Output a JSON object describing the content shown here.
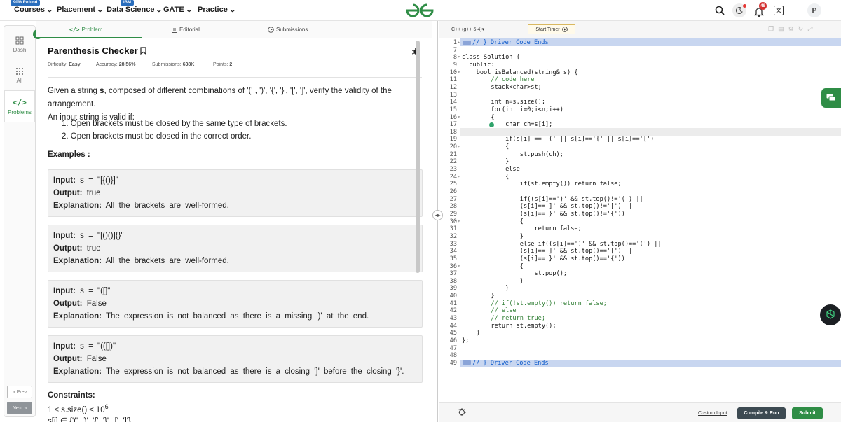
{
  "topnav": {
    "courses": "Courses",
    "courses_badge": "90% Refund",
    "placement": "Placement",
    "data_science": "Data Science",
    "data_science_badge": "IBM",
    "gate": "GATE",
    "practice": "Practice",
    "notification_count": "48",
    "avatar_letter": "P"
  },
  "sidebar": {
    "dash": "Dash",
    "all": "All",
    "problems": "Problems",
    "prev": "« Prev",
    "next": "Next »"
  },
  "tabs": {
    "problem": "Problem",
    "editorial": "Editorial",
    "submissions": "Submissions"
  },
  "problem": {
    "title": "Parenthesis Checker",
    "difficulty_label": "Difficulty:",
    "difficulty": "Easy",
    "accuracy_label": "Accuracy:",
    "accuracy": "28.56%",
    "submissions_label": "Submissions:",
    "submissions": "638K+",
    "points_label": "Points:",
    "points": "2",
    "desc_prefix": "Given a string ",
    "desc_var": "s",
    "desc_suffix": ", composed of different combinations of '(' , ')', '{', '}', '[', ']', verify the validity of the arrangement.",
    "desc_line2": "An input string is valid if:",
    "rules": [
      "1. Open brackets must be closed by the same type of brackets.",
      "2. Open brackets must be closed in the correct order."
    ],
    "examples_title": "Examples :",
    "input_label": "Input:",
    "output_label": "Output:",
    "explanation_label": "Explanation:",
    "examples": [
      {
        "input": "s = \"[{()}]\"",
        "output": "true",
        "explanation": "All the brackets are well-formed."
      },
      {
        "input": "s = \"[()()]{}\"",
        "output": "true",
        "explanation": "All the brackets are well-formed."
      },
      {
        "input": "s = \"([]\"",
        "output": "False",
        "explanation": "The expression is not balanced as there is a missing ')' at the end."
      },
      {
        "input": "s = \"(([])\"",
        "output": "False",
        "explanation": "The expression is not balanced as there is a closing ']' before the closing '}'."
      }
    ],
    "constraints_title": "Constraints:",
    "constraint_1": "1 ≤ s.size() ≤ 10",
    "constraint_1_exp": "6",
    "constraint_2": "s[i] ∈ {'(', ')', '{', '}', '[', ']'}"
  },
  "editor": {
    "language": "C++ (g++ 5.4)",
    "start_timer": "Start Timer",
    "custom_input": "Custom Input",
    "compile_run": "Compile & Run",
    "submit": "Submit",
    "line_numbers": [
      "1",
      "7",
      "8",
      "9",
      "10",
      "11",
      "12",
      "13",
      "14",
      "15",
      "16",
      "17",
      "18",
      "19",
      "20",
      "21",
      "22",
      "23",
      "24",
      "25",
      "26",
      "27",
      "28",
      "29",
      "30",
      "31",
      "32",
      "33",
      "34",
      "35",
      "36",
      "37",
      "38",
      "39",
      "40",
      "41",
      "42",
      "43",
      "44",
      "45",
      "46",
      "47",
      "48",
      "49"
    ],
    "code": {
      "l1": "// } Driver Code Ends",
      "l8": "class Solution {",
      "l9": "  public:",
      "l10": "    bool isBalanced(string& s) {",
      "l11": "        // code here",
      "l12": "        stack<char>st;",
      "l14": "        int n=s.size();",
      "l15": "        for(int i=0;i<n;i++)",
      "l16": "        {",
      "l17": "            char ch=s[i];",
      "l19": "            if(s[i] == '(' || s[i]=='{' || s[i]=='[')",
      "l20": "            {",
      "l21": "                st.push(ch);",
      "l22": "            }",
      "l23": "            else",
      "l24": "            {",
      "l25": "                if(st.empty()) return false;",
      "l27": "                if((s[i]==')' && st.top()!='(') ||",
      "l28": "                (s[i]==']' && st.top()!='[') ||",
      "l29": "                (s[i]=='}' && st.top()!='{'))",
      "l30": "                {",
      "l31": "                    return false;",
      "l32": "                }",
      "l33": "                else if((s[i]==')' && st.top()=='(') ||",
      "l34": "                (s[i]==']' && st.top()=='[') ||",
      "l35": "                (s[i]=='}' && st.top()=='{'))",
      "l36": "                {",
      "l37": "                    st.pop();",
      "l38": "                }",
      "l39": "            }",
      "l40": "        }",
      "l41": "        // if(!st.empty()) return false;",
      "l42": "        // else",
      "l43": "        // return true;",
      "l44": "        return st.empty();",
      "l45": "    }",
      "l46": "};",
      "l49": "// } Driver Code Ends"
    }
  },
  "colors": {
    "accent": "#2f8d46",
    "run_button": "#3d4a52",
    "submit_button": "#2f8d46",
    "highlight_line": "#e4ebf7",
    "driver_line": "#c8d6f0"
  }
}
